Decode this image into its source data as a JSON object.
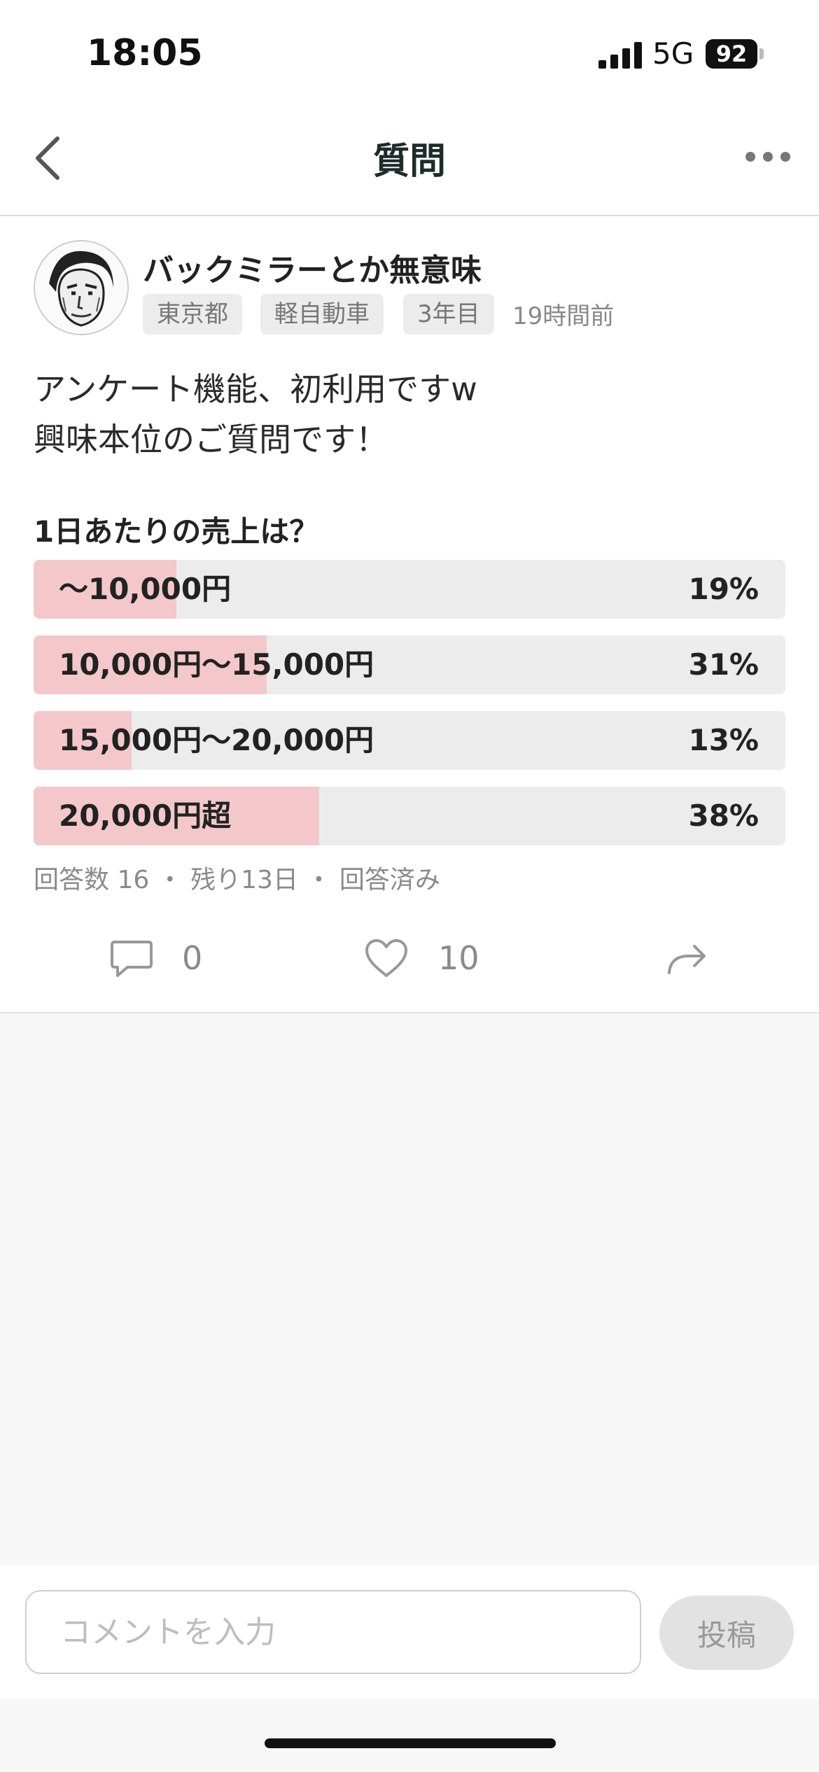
{
  "status_bar": {
    "time": "18:05",
    "network": "5G",
    "battery": "92"
  },
  "nav": {
    "title": "質問"
  },
  "post": {
    "author": "バックミラーとか無意味",
    "tags": [
      "東京都",
      "軽自動車",
      "3年目"
    ],
    "time_ago": "19時間前",
    "body_lines": [
      "アンケート機能、初利用ですw",
      "興味本位のご質問です！"
    ]
  },
  "poll": {
    "question": "1日あたりの売上は？",
    "options": [
      {
        "label": "〜10,000円",
        "percent": "19%",
        "fill_fraction": 0.19
      },
      {
        "label": "10,000円〜15,000円",
        "percent": "31%",
        "fill_fraction": 0.31
      },
      {
        "label": "15,000円〜20,000円",
        "percent": "13%",
        "fill_fraction": 0.13
      },
      {
        "label": "20,000円超",
        "percent": "38%",
        "fill_fraction": 0.38
      }
    ],
    "meta": "回答数 16 ・ 残り13日 ・ 回答済み",
    "fill_color": "#f4c8cb",
    "track_color": "#ececec"
  },
  "actions": {
    "comment_count": "0",
    "like_count": "10"
  },
  "comment": {
    "placeholder": "コメントを入力",
    "submit_label": "投稿"
  },
  "icons": [
    "back-chevron-icon",
    "more-icon",
    "comment-bubble-icon",
    "heart-icon",
    "share-icon"
  ]
}
